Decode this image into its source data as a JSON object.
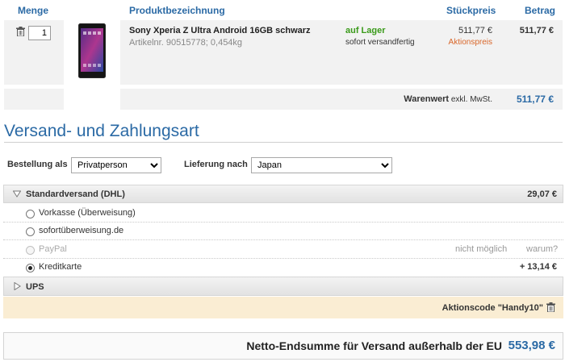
{
  "cart": {
    "headers": {
      "menge": "Menge",
      "produkt": "Produktbezeichnung",
      "stueckpreis": "Stückpreis",
      "betrag": "Betrag"
    },
    "item": {
      "quantity": "1",
      "name": "Sony Xperia Z Ultra Android 16GB schwarz",
      "article": "Artikelnr. 90515778; 0,454kg",
      "stock_status": "auf Lager",
      "shipping_ready": "sofort versandfertig",
      "unit_price": "511,77 €",
      "price_note": "Aktionspreis",
      "total": "511,77 €"
    },
    "subtotal_label": "Warenwert",
    "subtotal_suffix": "exkl. MwSt.",
    "subtotal_value": "511,77 €"
  },
  "shipping": {
    "title": "Versand- und Zahlungsart",
    "order_as_label": "Bestellung als",
    "order_as_value": "Privatperson",
    "delivery_label": "Lieferung nach",
    "delivery_value": "Japan",
    "standard": {
      "label": "Standardversand (DHL)",
      "price": "29,07 €"
    },
    "payments": [
      {
        "label": "Vorkasse (Überweisung)"
      },
      {
        "label": "sofortüberweisung.de"
      },
      {
        "label": "PayPal",
        "note": "nicht möglich",
        "why": "warum?"
      },
      {
        "label": "Kreditkarte",
        "surcharge": "+ 13,14 €"
      }
    ],
    "ups_label": "UPS",
    "promo_code": "Aktionscode \"Handy10\""
  },
  "total": {
    "label": "Netto-Endsumme für Versand außerhalb der EU",
    "value": "553,98 €"
  },
  "colors": {
    "accent_blue": "#2b6aa5",
    "in_stock_green": "#3a9a1a",
    "promo_orange": "#d9672a",
    "promo_bg": "#faedd3"
  }
}
